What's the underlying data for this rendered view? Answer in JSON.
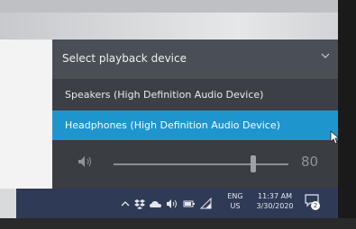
{
  "flyout": {
    "title": "Select playback device",
    "devices": [
      {
        "label": "Speakers (High Definition Audio Device)",
        "selected": false
      },
      {
        "label": "Headphones (High Definition Audio Device)",
        "selected": true
      }
    ],
    "volume": {
      "value": "80",
      "level": 0.8
    }
  },
  "taskbar": {
    "language": {
      "line1": "ENG",
      "line2": "US"
    },
    "clock": {
      "time": "11:37 AM",
      "date": "3/30/2020"
    },
    "notifications": {
      "count": "2"
    },
    "tray_icons": [
      "chevron-up-icon",
      "dropbox-icon",
      "onedrive-icon",
      "speaker-icon",
      "battery-icon",
      "wifi-icon"
    ]
  },
  "colors": {
    "selected_row": "#1e96cd",
    "flyout_bg": "#3a3d42",
    "header_bg": "#4a4e55",
    "taskbar_bg": "#2f3a57"
  }
}
